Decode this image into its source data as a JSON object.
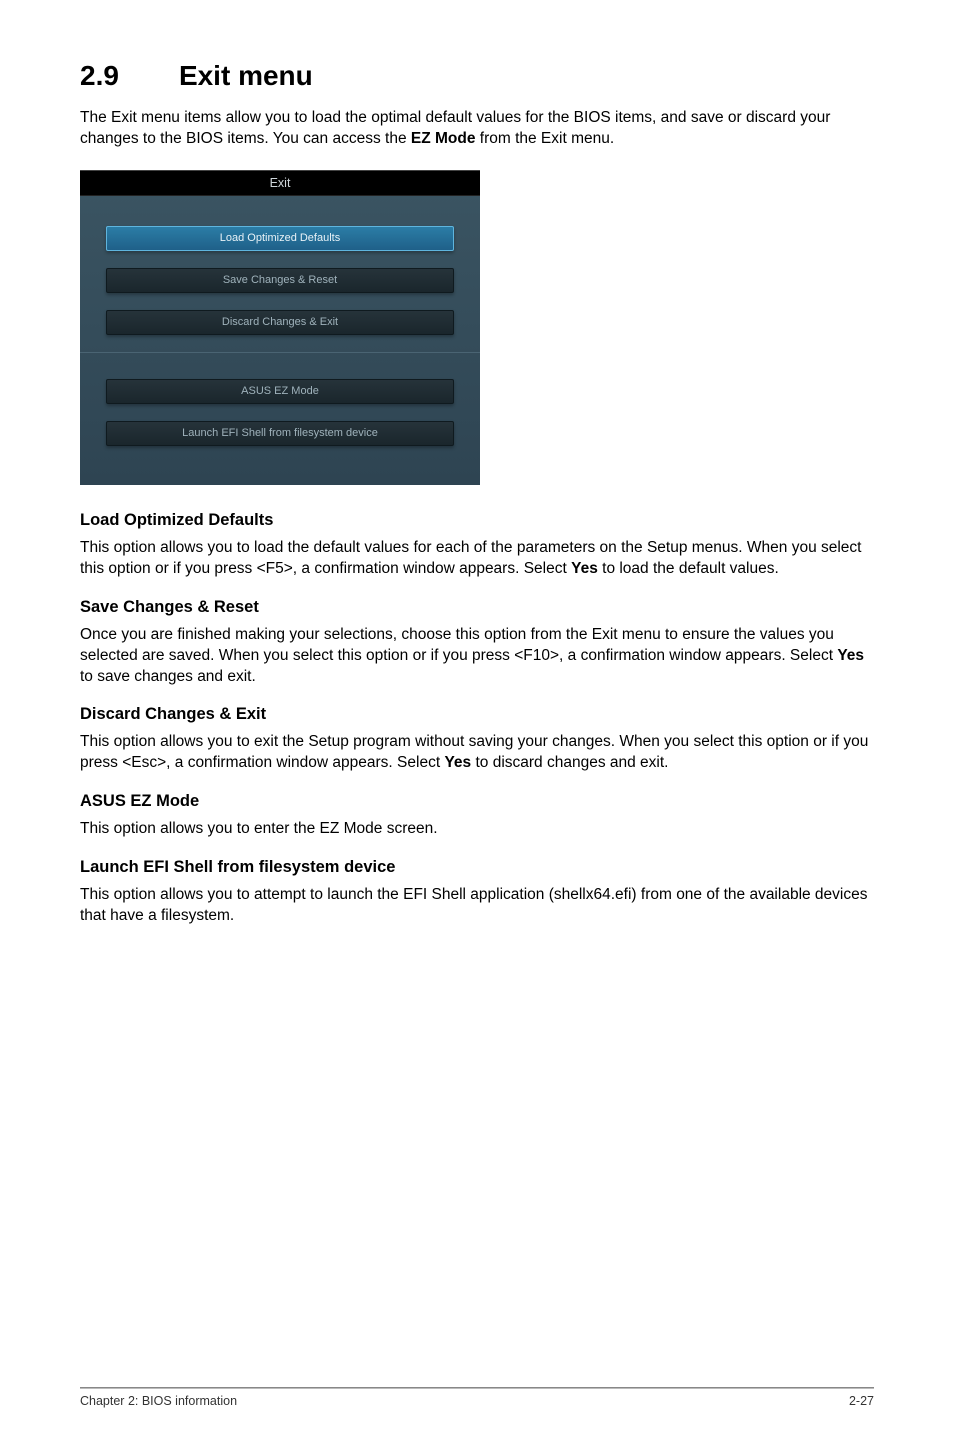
{
  "section": {
    "number": "2.9",
    "title": "Exit menu"
  },
  "intro": {
    "pre": "The Exit menu items allow you to load the optimal default values for the BIOS items, and save or discard your changes to the BIOS items. You can access the ",
    "bold": "EZ Mode",
    "post": " from the Exit menu."
  },
  "bios": {
    "header": "Exit",
    "buttons": {
      "load_defaults": "Load Optimized Defaults",
      "save_reset": "Save Changes & Reset",
      "discard_exit": "Discard Changes & Exit",
      "ez_mode": "ASUS EZ Mode",
      "launch_efi": "Launch EFI Shell from filesystem device"
    }
  },
  "sections": {
    "load_defaults": {
      "heading": "Load Optimized Defaults",
      "text_pre": "This option allows you to load the default values for each of the parameters on the Setup menus. When you select this option or if you press <F5>, a confirmation window appears. Select ",
      "text_bold": "Yes",
      "text_post": " to load the default values."
    },
    "save_reset": {
      "heading": "Save Changes & Reset",
      "text_pre": "Once you are finished making your selections, choose this option from the Exit menu to ensure the values you selected are saved. When you select this option or if you press <F10>, a confirmation window appears. Select ",
      "text_bold": "Yes",
      "text_post": " to save changes and exit."
    },
    "discard_exit": {
      "heading": "Discard Changes & Exit",
      "text_pre": "This option allows you to exit the Setup program without saving your changes. When you select this option or if you press <Esc>, a confirmation window appears. Select ",
      "text_bold": "Yes",
      "text_post": " to discard changes and exit."
    },
    "ez_mode": {
      "heading": "ASUS EZ Mode",
      "text": "This option allows you to enter the EZ Mode screen."
    },
    "launch_efi": {
      "heading": "Launch EFI Shell from filesystem device",
      "text": "This option allows you to attempt to launch the EFI Shell application (shellx64.efi) from one of the available devices that have a filesystem."
    }
  },
  "footer": {
    "left": "Chapter 2: BIOS information",
    "right": "2-27"
  }
}
